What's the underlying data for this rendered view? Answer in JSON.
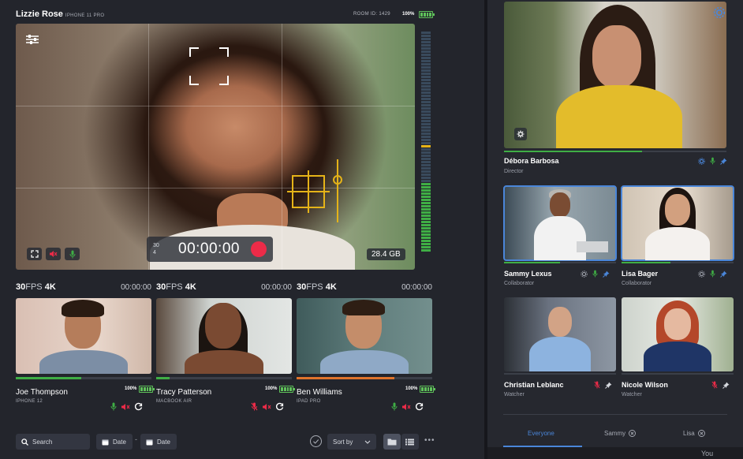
{
  "header": {
    "user_name": "Lizzie Rose",
    "device": "IPHONE 11 PRO",
    "room_label": "ROOM ID: 1429",
    "battery": "100%"
  },
  "main_video": {
    "fps_small": "30",
    "fps_small_sub": "4",
    "timer": "00:00:00",
    "storage": "28.4 GB"
  },
  "sources": [
    {
      "fps": "30",
      "fps_unit": "FPS",
      "res": "4K",
      "time": "00:00:00",
      "name": "Joe Thompson",
      "device": "IPHONE 12",
      "battery": "100%",
      "progress": 0.48,
      "progress_color": "#3fae45"
    },
    {
      "fps": "30",
      "fps_unit": "FPS",
      "res": "4K",
      "time": "00:00:00",
      "name": "Tracy Patterson",
      "device": "MACBOOK AIR",
      "battery": "100%",
      "progress": 0.1,
      "progress_color": "#3fae45"
    },
    {
      "fps": "30",
      "fps_unit": "FPS",
      "res": "4K",
      "time": "00:00:00",
      "name": "Ben Williams",
      "device": "IPAD PRO",
      "battery": "100%",
      "progress": 0.72,
      "progress_color": "#e0742b"
    }
  ],
  "toolbar": {
    "search_label": "Search",
    "date_from": "Date",
    "date_sep": "-",
    "date_to": "Date",
    "sort_label": "Sort by"
  },
  "participants": [
    {
      "name": "Débora Barbosa",
      "role": "Director"
    },
    {
      "name": "Sammy Lexus",
      "role": "Collaborator"
    },
    {
      "name": "Lisa Bager",
      "role": "Collaborator"
    },
    {
      "name": "Christian Leblanc",
      "role": "Watcher"
    },
    {
      "name": "Nicole Wilson",
      "role": "Watcher"
    }
  ],
  "chat": {
    "tabs": [
      "Everyone",
      "Sammy",
      "Lisa"
    ],
    "you_label": "You"
  },
  "colors": {
    "accent_blue": "#4a86d9",
    "green": "#3fae45",
    "red": "#ec2b48",
    "focus_yellow": "#e5b318"
  }
}
